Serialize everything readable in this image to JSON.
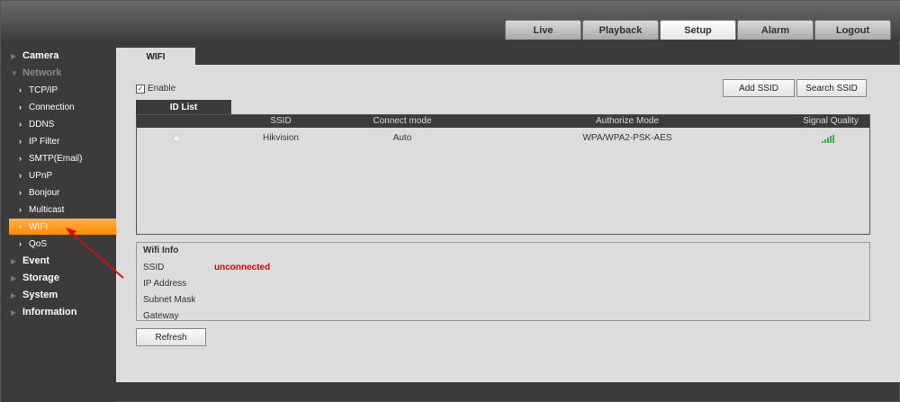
{
  "nav": {
    "tabs": [
      {
        "label": "Live"
      },
      {
        "label": "Playback"
      },
      {
        "label": "Setup",
        "active": true
      },
      {
        "label": "Alarm"
      },
      {
        "label": "Logout"
      }
    ]
  },
  "sidebar": {
    "camera": "Camera",
    "network": "Network",
    "network_items": [
      "TCP/IP",
      "Connection",
      "DDNS",
      "IP Filter",
      "SMTP(Email)",
      "UPnP",
      "Bonjour",
      "Multicast",
      "WIFI",
      "QoS"
    ],
    "active_item": "WIFI",
    "event": "Event",
    "storage": "Storage",
    "system": "System",
    "information": "Information"
  },
  "page": {
    "tab_title": "WIFI",
    "enable_label": "Enable",
    "enable_checked": true,
    "add_ssid": "Add SSID",
    "search_ssid": "Search SSID",
    "id_list_tab": "ID List",
    "refresh": "Refresh"
  },
  "table": {
    "headers": [
      "SSID",
      "Connect mode",
      "Authorize Mode",
      "Signal Quality"
    ],
    "rows": [
      {
        "ssid": "Hikvision",
        "connect_mode": "Auto",
        "authorize_mode": "WPA/WPA2-PSK-AES",
        "signal_icon": "signal-bars-icon"
      }
    ]
  },
  "wifi_info": {
    "title": "Wifi Info",
    "ssid_label": "SSID",
    "ssid_value": "unconnected",
    "ip_label": "IP Address",
    "subnet_label": "Subnet Mask",
    "gateway_label": "Gateway"
  },
  "colors": {
    "accent_orange": "#ff9a1a",
    "status_red": "#e00000",
    "signal_green": "#3cb043"
  }
}
